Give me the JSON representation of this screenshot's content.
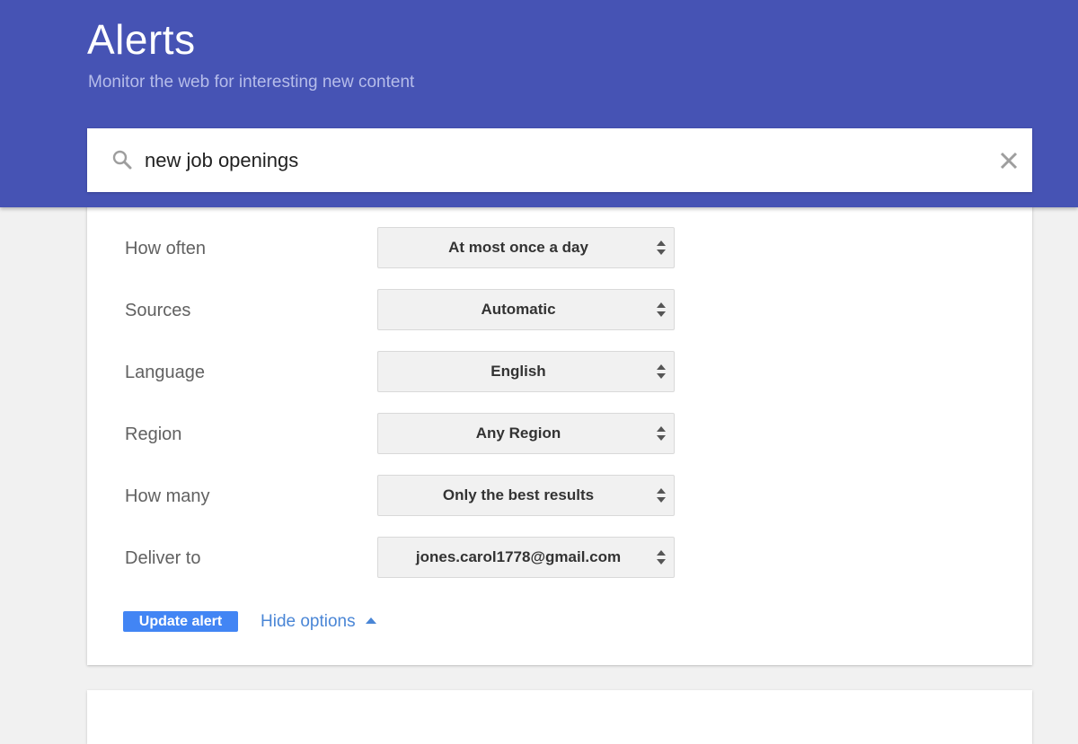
{
  "header": {
    "title": "Alerts",
    "subtitle": "Monitor the web for interesting new content",
    "background_color": "#4653b4"
  },
  "search": {
    "icon": "search-icon",
    "value": "new job openings",
    "clear_icon": "close-icon"
  },
  "options": {
    "rows": [
      {
        "label": "How often",
        "value": "At most once a day"
      },
      {
        "label": "Sources",
        "value": "Automatic"
      },
      {
        "label": "Language",
        "value": "English"
      },
      {
        "label": "Region",
        "value": "Any Region"
      },
      {
        "label": "How many",
        "value": "Only the best results"
      },
      {
        "label": "Deliver to",
        "value": "jones.carol1778@gmail.com"
      }
    ],
    "update_label": "Update alert",
    "hide_options_label": "Hide options",
    "accent_color": "#4285f4",
    "link_color": "#4a86d6"
  }
}
